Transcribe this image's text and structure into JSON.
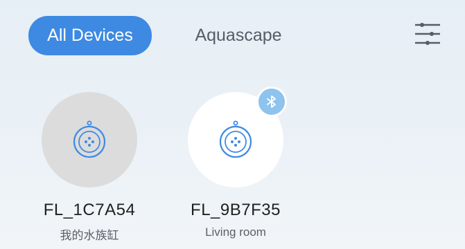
{
  "tabs": [
    {
      "label": "All Devices",
      "active": true
    },
    {
      "label": "Aquascape",
      "active": false
    }
  ],
  "filter_icon": "sliders-icon",
  "devices": [
    {
      "name": "FL_1C7A54",
      "location": "我的水族缸",
      "status": "offline",
      "icon": "lamp-icon"
    },
    {
      "name": "FL_9B7F35",
      "location": "Living room",
      "status": "online",
      "icon": "lamp-icon",
      "badge": "bluetooth-icon"
    }
  ],
  "colors": {
    "accent": "#3e8ae2",
    "icon_blue": "#3e8ae2",
    "badge_blue": "#8ec3ee",
    "offline_gray": "#dcdcdd"
  }
}
